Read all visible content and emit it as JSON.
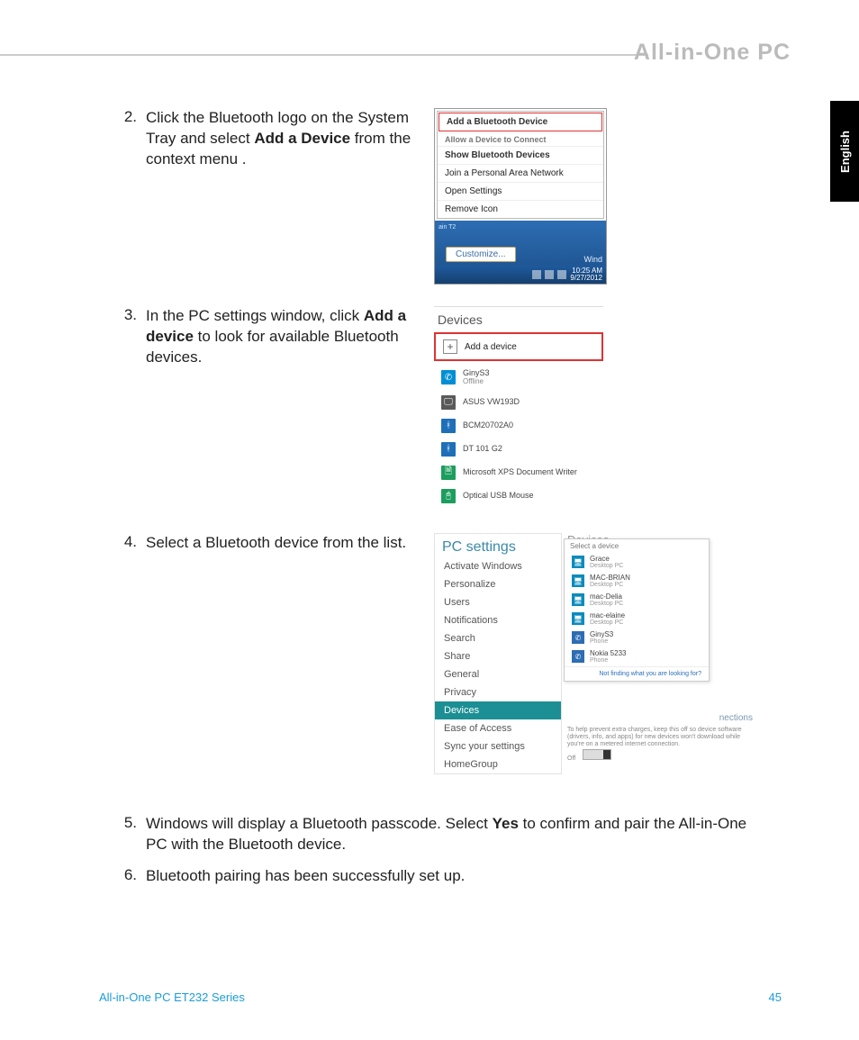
{
  "header": {
    "title": "All-in-One PC"
  },
  "lang_tab": "English",
  "steps": [
    {
      "num": "2.",
      "text_parts": [
        "Click the Bluetooth logo on the System Tray and select ",
        "Add a Device",
        " from the context menu ."
      ]
    },
    {
      "num": "3.",
      "text_parts": [
        "In the PC settings window, click ",
        "Add a device",
        " to look for available Bluetooth devices."
      ]
    },
    {
      "num": "4.",
      "text_parts": [
        "Select a Bluetooth device from the list."
      ]
    },
    {
      "num": "5.",
      "text_parts": [
        "Windows will display a Bluetooth passcode. Select ",
        "Yes",
        " to confirm and pair the All-in-One PC with the Bluetooth device."
      ]
    },
    {
      "num": "6.",
      "text_parts": [
        "Bluetooth pairing has been successfully set up."
      ]
    }
  ],
  "fig1": {
    "menu": {
      "highlight": "Add a Bluetooth Device",
      "gray_caption": "Allow a Device to Connect",
      "items": [
        "Show Bluetooth Devices",
        "Join a Personal Area Network",
        "Open Settings",
        "Remove Icon"
      ]
    },
    "customize_btn": "Customize...",
    "wind_text": "Wind",
    "taskbar_time": "10:25 AM",
    "taskbar_date": "9/27/2012"
  },
  "fig2": {
    "header": "Devices",
    "add_label": "Add a device",
    "devices": [
      {
        "icon": "phone",
        "name": "GinyS3",
        "sub": "Offline"
      },
      {
        "icon": "monitor",
        "name": "ASUS VW193D",
        "sub": ""
      },
      {
        "icon": "bt",
        "name": "BCM20702A0",
        "sub": ""
      },
      {
        "icon": "bt",
        "name": "DT 101 G2",
        "sub": ""
      },
      {
        "icon": "doc",
        "name": "Microsoft XPS Document Writer",
        "sub": ""
      },
      {
        "icon": "mouse",
        "name": "Optical USB Mouse",
        "sub": ""
      }
    ]
  },
  "fig3": {
    "sidebar_title": "PC settings",
    "sidebar_items": [
      "Activate Windows",
      "Personalize",
      "Users",
      "Notifications",
      "Search",
      "Share",
      "General",
      "Privacy",
      "Devices",
      "Ease of Access",
      "Sync your settings",
      "HomeGroup"
    ],
    "sidebar_active_index": 8,
    "right_header": "Devices",
    "pop_title": "Select a device",
    "pop_devices": [
      {
        "icon": "pc",
        "name": "Grace",
        "sub": "Desktop PC"
      },
      {
        "icon": "pc",
        "name": "MAC-BRIAN",
        "sub": "Desktop PC"
      },
      {
        "icon": "pc",
        "name": "mac-Delia",
        "sub": "Desktop PC"
      },
      {
        "icon": "pc",
        "name": "mac-elaine",
        "sub": "Desktop PC"
      },
      {
        "icon": "phone",
        "name": "GinyS3",
        "sub": "Phone"
      },
      {
        "icon": "phone",
        "name": "Nokia 5233",
        "sub": "Phone"
      }
    ],
    "pop_footer": "Not finding what you are looking for?",
    "behind_text": "nections",
    "metered_text": "To help prevent extra charges, keep this off so device software (drivers, info, and apps) for new devices won't download while you're on a metered internet connection.",
    "metered_off": "Off"
  },
  "footer": {
    "left": "All-in-One PC ET232 Series",
    "right": "45"
  }
}
